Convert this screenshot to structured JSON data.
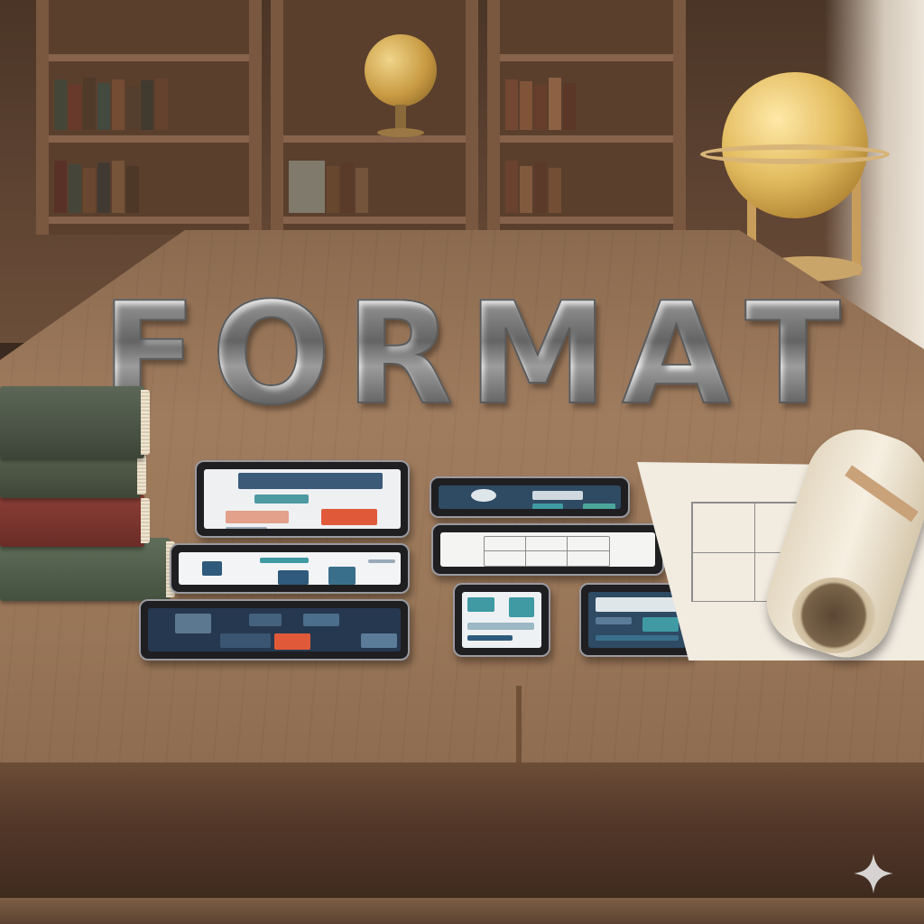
{
  "scene": {
    "title_letters": [
      "F",
      "O",
      "R",
      "M",
      "A",
      "T"
    ]
  },
  "icons": [
    "sparkle-icon"
  ],
  "colors": {
    "wood": "#9a7759",
    "metal": "#d9d9d9",
    "screen_dark": "#2f4a63",
    "accent_red": "#e05a3a",
    "accent_teal": "#3f9aa3",
    "paper": "#f1ebe0"
  }
}
